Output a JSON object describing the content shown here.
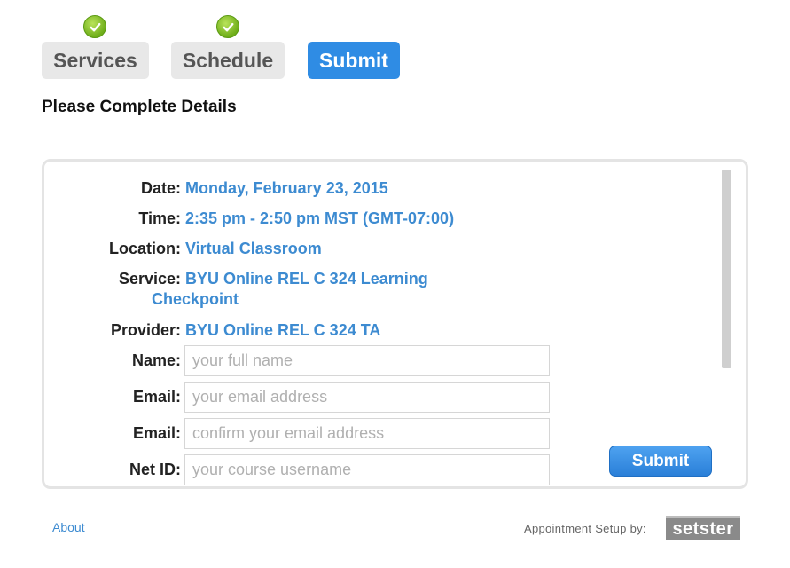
{
  "steps": [
    {
      "label": "Services",
      "state": "done"
    },
    {
      "label": "Schedule",
      "state": "done"
    },
    {
      "label": "Submit",
      "state": "active"
    }
  ],
  "heading": "Please Complete Details",
  "details": {
    "date_label": "Date:",
    "date_value": "Monday, February 23, 2015",
    "time_label": "Time:",
    "time_value": "2:35 pm - 2:50 pm MST (GMT-07:00)",
    "location_label": "Location:",
    "location_value": "Virtual Classroom",
    "service_label": "Service:",
    "service_value_line1": "BYU Online REL C 324 Learning",
    "service_value_line2": "Checkpoint",
    "provider_label": "Provider:",
    "provider_value": "BYU Online REL C 324 TA"
  },
  "form": {
    "name_label": "Name:",
    "name_placeholder": "your full name",
    "email_label": "Email:",
    "email_placeholder": "your email address",
    "email_confirm_label": "Email:",
    "email_confirm_placeholder": "confirm your email address",
    "netid_label": "Net ID:",
    "netid_placeholder": "your course username",
    "submit_label": "Submit"
  },
  "footer": {
    "about_label": "About",
    "powered_by": "Appointment Setup by:",
    "logo_text": "setster"
  },
  "colors": {
    "accent": "#2f8ce4",
    "value_text": "#3d8bd1",
    "check_green": "#7dbb22"
  }
}
